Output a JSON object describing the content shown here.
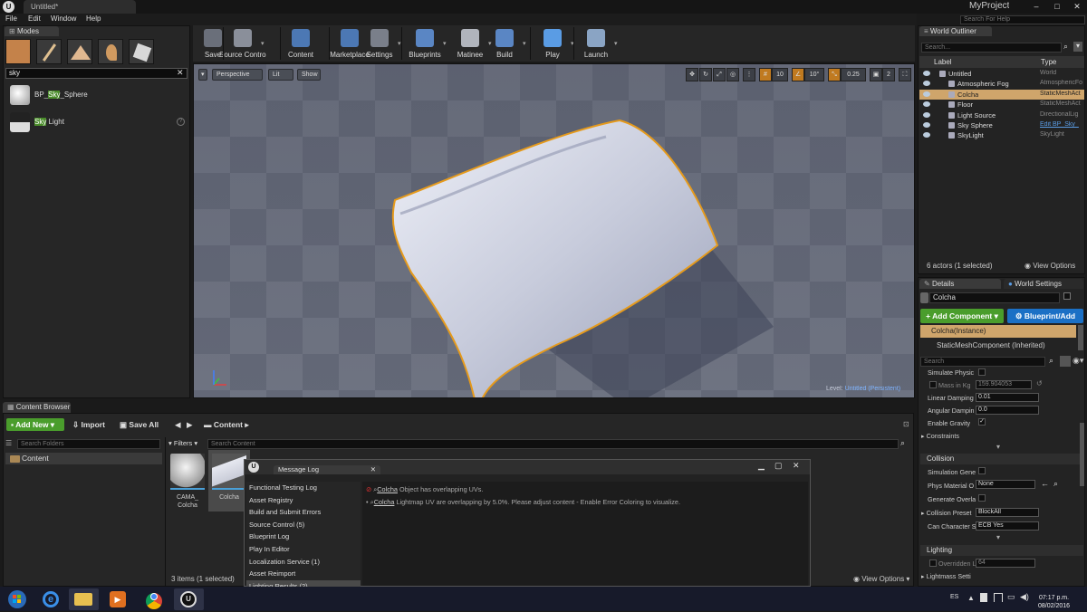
{
  "titlebar": {
    "doc_tab": "Untitled*",
    "project": "MyProject",
    "logo": "U"
  },
  "menu": [
    "File",
    "Edit",
    "Window",
    "Help"
  ],
  "search_help": {
    "placeholder": "Search For Help"
  },
  "modes": {
    "tab": "Modes",
    "search_value": "sky",
    "items": [
      {
        "pre": "BP_",
        "hl": "Sky",
        "post": "_Sphere",
        "icon": "sphere-icon"
      },
      {
        "pre": "",
        "hl": "Sky",
        "post": " Light",
        "icon": "skylight-icon"
      }
    ]
  },
  "toolbar": {
    "buttons": [
      {
        "label": "Save",
        "icon": "save-icon",
        "color": "#6a6f7a"
      },
      {
        "label": "Source Control",
        "icon": "source-control-icon",
        "color": "#8a8f9a"
      },
      {
        "label": "Content",
        "icon": "content-icon",
        "color": "#4c78b4"
      },
      {
        "label": "Marketplace",
        "icon": "marketplace-icon",
        "color": "#4c78b4"
      },
      {
        "label": "Settings",
        "icon": "settings-icon",
        "color": "#7a7f8a"
      },
      {
        "label": "Blueprints",
        "icon": "blueprints-icon",
        "color": "#5a86c4"
      },
      {
        "label": "Matinee",
        "icon": "matinee-icon",
        "color": "#b0b4bc"
      },
      {
        "label": "Build",
        "icon": "build-icon",
        "color": "#5a86c4"
      },
      {
        "label": "Play",
        "icon": "play-icon",
        "color": "#5a9ce4"
      },
      {
        "label": "Launch",
        "icon": "launch-icon",
        "color": "#8aa4c4"
      }
    ]
  },
  "viewport": {
    "perspective": "Perspective",
    "lit": "Lit",
    "show": "Show",
    "grid_snap": "10",
    "rot_snap": "10°",
    "scale_snap": "0.25",
    "cam_speed": "2",
    "level_prefix": "Level:",
    "level_name": "Untitled (Persistent)"
  },
  "outliner": {
    "tab": "World Outliner",
    "search_placeholder": "Search...",
    "col_label": "Label",
    "col_type": "Type",
    "rows": [
      {
        "name": "Untitled",
        "type": "World",
        "indent": 0,
        "selected": false
      },
      {
        "name": "Atmospheric Fog",
        "type": "AtmosphericFo",
        "indent": 1,
        "selected": false
      },
      {
        "name": "Colcha",
        "type": "StaticMeshAct",
        "indent": 1,
        "selected": true
      },
      {
        "name": "Floor",
        "type": "StaticMeshAct",
        "indent": 1,
        "selected": false
      },
      {
        "name": "Light Source",
        "type": "DirectionalLig",
        "indent": 1,
        "selected": false
      },
      {
        "name": "Sky Sphere",
        "type": "Edit BP_Sky_",
        "indent": 1,
        "selected": false
      },
      {
        "name": "SkyLight",
        "type": "SkyLight",
        "indent": 1,
        "selected": false
      }
    ],
    "footer": "6 actors (1 selected)",
    "view_options": "View Options"
  },
  "details": {
    "tab": "Details",
    "world_settings_tab": "World Settings",
    "name_value": "Colcha",
    "add_component": "+ Add Component",
    "blueprint_add": "Blueprint/Add",
    "component_instance": "Colcha(Instance)",
    "component_inherited": "StaticMeshComponent (Inherited)",
    "search_placeholder": "Search",
    "physics": {
      "simulate_physics": "Simulate Physic",
      "mass_label": "Mass in Kg",
      "mass_value": "159.904053",
      "linear_damping_label": "Linear Damping",
      "linear_damping": "0.01",
      "angular_damping_label": "Angular Dampin",
      "angular_damping": "0.0",
      "enable_gravity": "Enable Gravity",
      "constraints": "Constraints"
    },
    "collision": {
      "section": "Collision",
      "sim_gen": "Simulation Gene",
      "phys_material_label": "Phys Material O",
      "phys_material_value": "None",
      "gen_overlap": "Generate Overla",
      "preset_label": "Collision Preset",
      "preset_value": "BlockAll",
      "can_char_label": "Can Character S",
      "can_char_value": "ECB Yes"
    },
    "lighting": {
      "section": "Lighting",
      "overridden_label": "Overridden L",
      "overridden_value": "64",
      "lightmass": "Lightmass Setti"
    }
  },
  "content_browser": {
    "tab": "Content Browser",
    "add_new": "Add New",
    "import": "Import",
    "save_all": "Save All",
    "path": "Content",
    "folders_placeholder": "Search Folders",
    "folder": "Content",
    "filters": "Filters",
    "content_placeholder": "Search Content",
    "assets": [
      {
        "name": "CAMA_\nColcha"
      },
      {
        "name": "Colcha"
      }
    ],
    "items_selected": "3 items (1 selected)",
    "view_options": "View Options"
  },
  "message_log": {
    "title": "Message Log",
    "categories": [
      "Functional Testing Log",
      "Asset Registry",
      "Build and Submit Errors",
      "Source Control (5)",
      "Blueprint Log",
      "Play In Editor",
      "Localization Service (1)",
      "Asset Reimport",
      "Lighting Results (2)",
      "Map Check (1)"
    ],
    "selected_category": "Lighting Results (2)",
    "messages": [
      {
        "link": "Colcha",
        "text": "Object has overlapping UVs."
      },
      {
        "link": "Colcha",
        "text": "Lightmap UV are overlapping by 5.0%. Please adjust content - Enable Error Coloring to visualize."
      }
    ]
  },
  "taskbar": {
    "lang": "ES",
    "time": "07:17 p.m.",
    "date": "08/02/2016",
    "apps": [
      "start-icon",
      "ie-icon",
      "explorer-icon",
      "media-icon",
      "chrome-icon",
      "unreal-icon"
    ]
  }
}
